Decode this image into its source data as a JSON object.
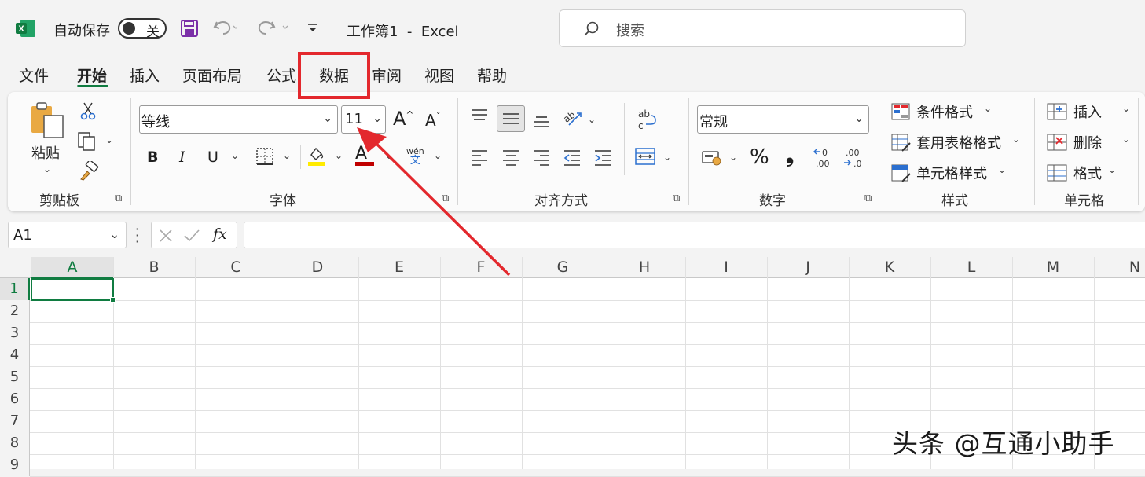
{
  "titlebar": {
    "autosave_label": "自动保存",
    "autosave_state": "关",
    "title": "工作簿1  -  Excel",
    "search_placeholder": "搜索"
  },
  "tabs": [
    "文件",
    "开始",
    "插入",
    "页面布局",
    "公式",
    "数据",
    "审阅",
    "视图",
    "帮助"
  ],
  "active_tab": "开始",
  "highlighted_tab": "数据",
  "ribbon": {
    "clipboard": {
      "paste_label": "粘贴",
      "group_title": "剪贴板"
    },
    "font": {
      "font_name": "等线",
      "font_size": "11",
      "phonetic_top": "wén",
      "phonetic_bottom": "文",
      "group_title": "字体",
      "bold": "B",
      "italic": "I",
      "underline": "U",
      "font_color_glyph": "A"
    },
    "alignment": {
      "group_title": "对齐方式"
    },
    "number": {
      "format": "常规",
      "percent": "%",
      "comma": "❟",
      "group_title": "数字"
    },
    "styles": {
      "conditional": "条件格式",
      "table_format": "套用表格格式",
      "cell_styles": "单元格样式",
      "group_title": "样式"
    },
    "cells": {
      "insert": "插入",
      "delete": "删除",
      "format": "格式",
      "group_title": "单元格"
    }
  },
  "formula_bar": {
    "name_box": "A1",
    "fx": "fx"
  },
  "grid": {
    "columns": [
      "A",
      "B",
      "C",
      "D",
      "E",
      "F",
      "G",
      "H",
      "I",
      "J",
      "K",
      "L",
      "M",
      "N"
    ],
    "rows": [
      "1",
      "2",
      "3",
      "4",
      "5",
      "6",
      "7",
      "8",
      "9"
    ],
    "selected_cell": "A1"
  },
  "watermark": "头条 @互通小助手",
  "colors": {
    "excel_green": "#107c41",
    "callout_red": "#e3282d",
    "accent_purple": "#7b2fa8"
  }
}
